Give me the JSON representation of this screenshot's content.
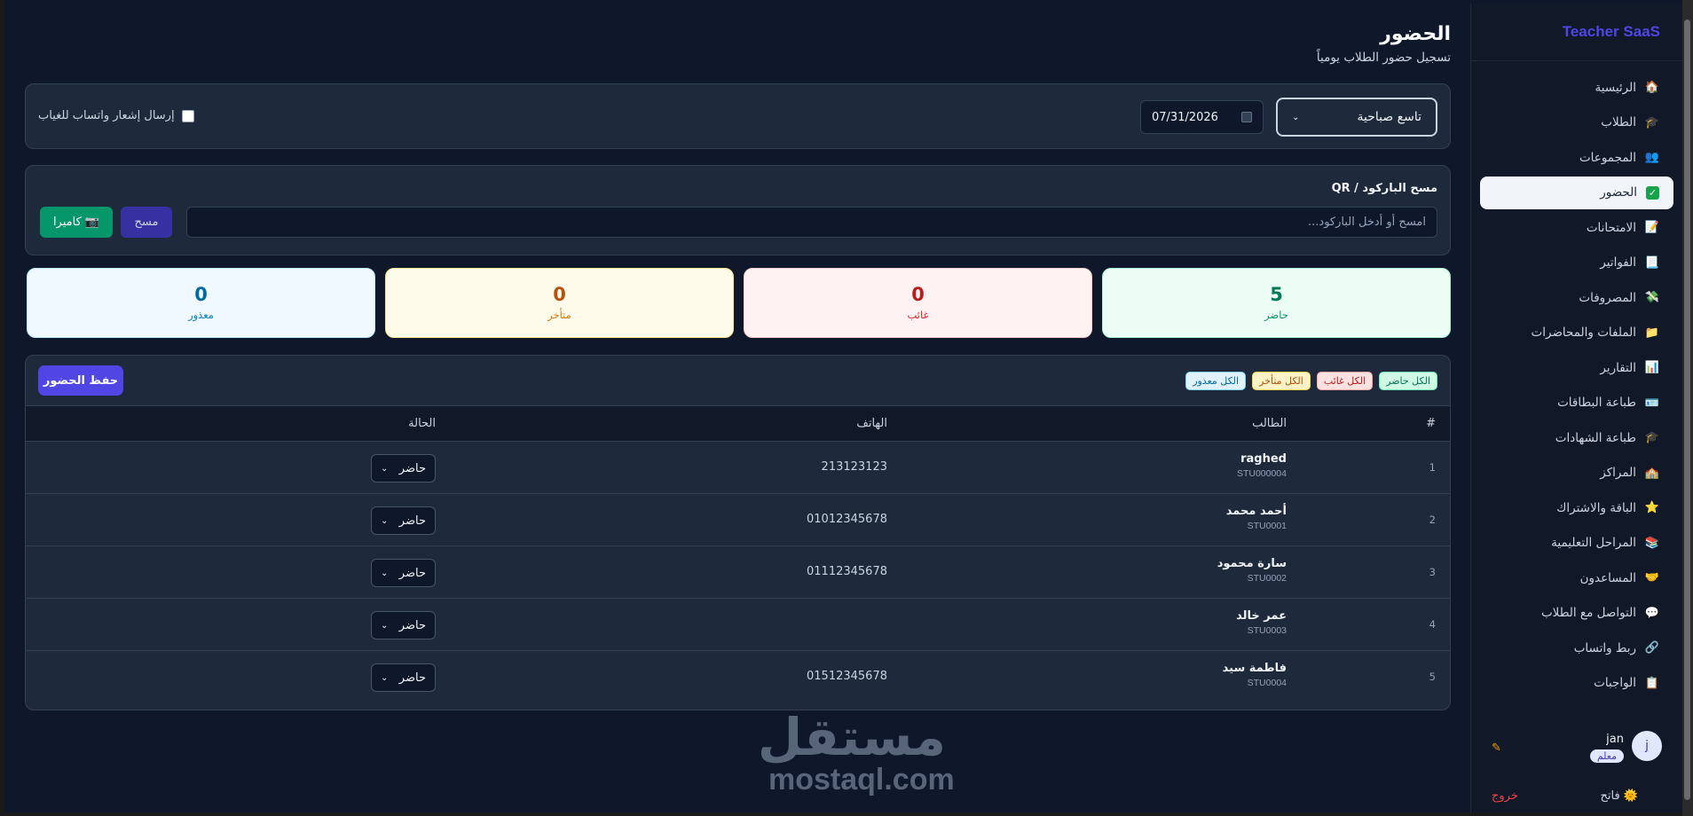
{
  "app": {
    "brand": "Teacher SaaS"
  },
  "sidebar": {
    "items": [
      {
        "label": "الرئيسية",
        "icon": "home-icon",
        "glyph": "🏠",
        "active": false
      },
      {
        "label": "الطلاب",
        "icon": "students-icon",
        "glyph": "🎓",
        "active": false
      },
      {
        "label": "المجموعات",
        "icon": "groups-icon",
        "glyph": "👥",
        "active": false
      },
      {
        "label": "الحضور",
        "icon": "attendance-check-icon",
        "glyph": "✓",
        "active": true
      },
      {
        "label": "الامتحانات",
        "icon": "exams-icon",
        "glyph": "📝",
        "active": false
      },
      {
        "label": "الفواتير",
        "icon": "invoices-icon",
        "glyph": "📃",
        "active": false
      },
      {
        "label": "المصروفات",
        "icon": "expenses-icon",
        "glyph": "💸",
        "active": false
      },
      {
        "label": "الملفات والمحاضرات",
        "icon": "folder-icon",
        "glyph": "📁",
        "active": false
      },
      {
        "label": "التقارير",
        "icon": "reports-icon",
        "glyph": "📊",
        "active": false
      },
      {
        "label": "طباعة البطاقات",
        "icon": "id-card-icon",
        "glyph": "🪪",
        "active": false
      },
      {
        "label": "طباعة الشهادات",
        "icon": "certificate-icon",
        "glyph": "🎓",
        "active": false
      },
      {
        "label": "المراكز",
        "icon": "school-icon",
        "glyph": "🏫",
        "active": false
      },
      {
        "label": "الباقة والاشتراك",
        "icon": "star-icon",
        "glyph": "⭐",
        "active": false
      },
      {
        "label": "المراحل التعليمية",
        "icon": "books-icon",
        "glyph": "📚",
        "active": false
      },
      {
        "label": "المساعدون",
        "icon": "handshake-icon",
        "glyph": "🤝",
        "active": false
      },
      {
        "label": "التواصل مع الطلاب",
        "icon": "chat-icon",
        "glyph": "💬",
        "active": false
      },
      {
        "label": "ربط واتساب",
        "icon": "link-icon",
        "glyph": "🔗",
        "active": false
      },
      {
        "label": "الواجبات",
        "icon": "homework-icon",
        "glyph": "📋",
        "active": false
      }
    ],
    "user": {
      "initial": "j",
      "name": "jan",
      "role": "معلم"
    },
    "theme_label": "فاتح",
    "logout_label": "خروج"
  },
  "page": {
    "title": "الحضور",
    "subtitle": "تسجيل حضور الطلاب يومياً"
  },
  "toolbar": {
    "group_value": "تاسع صباحية",
    "date_value": "07/31/2026",
    "whatsapp_label": "إرسال إشعار واتساب للغياب"
  },
  "scan": {
    "label": "مسح الباركود / QR",
    "placeholder": "امسح أو أدخل الباركود...",
    "scan_button": "مسح",
    "camera_button": "📷 كاميرا"
  },
  "stats": {
    "present": {
      "value": "5",
      "label": "حاضر"
    },
    "absent": {
      "value": "0",
      "label": "غائب"
    },
    "late": {
      "value": "0",
      "label": "متأخر"
    },
    "excused": {
      "value": "0",
      "label": "معذور"
    }
  },
  "bulk": {
    "all_present": "الكل حاضر",
    "all_absent": "الكل غائب",
    "all_late": "الكل متأخر",
    "all_excused": "الكل معذور",
    "save": "حفظ الحضور"
  },
  "table": {
    "columns": {
      "idx": "#",
      "student": "الطالب",
      "phone": "الهاتف",
      "status": "الحالة"
    },
    "rows": [
      {
        "idx": "1",
        "name": "raghed",
        "code": "STU000004",
        "phone": "213123123",
        "status": "حاضر"
      },
      {
        "idx": "2",
        "name": "أحمد محمد",
        "code": "STU0001",
        "phone": "01012345678",
        "status": "حاضر"
      },
      {
        "idx": "3",
        "name": "سارة محمود",
        "code": "STU0002",
        "phone": "01112345678",
        "status": "حاضر"
      },
      {
        "idx": "4",
        "name": "عمر خالد",
        "code": "STU0003",
        "phone": "",
        "status": "حاضر"
      },
      {
        "idx": "5",
        "name": "فاطمة سيد",
        "code": "STU0004",
        "phone": "01512345678",
        "status": "حاضر"
      }
    ]
  },
  "watermark": {
    "arabic": "مستقل",
    "latin": "mostaql.com"
  }
}
